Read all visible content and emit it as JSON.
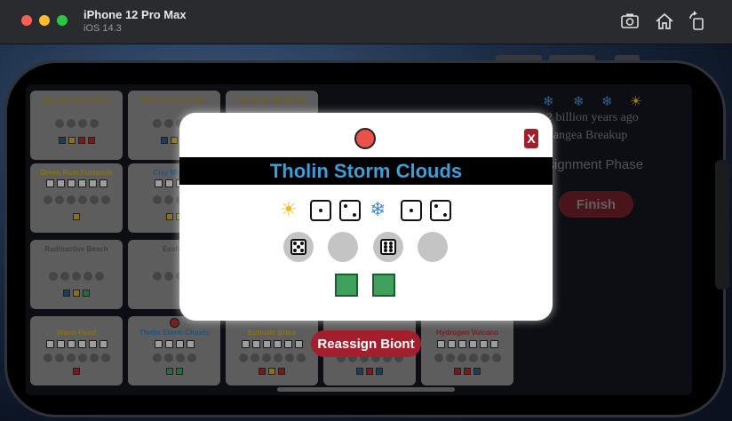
{
  "window": {
    "device_name": "iPhone 12 Pro Max",
    "os_version": "iOS 14.3"
  },
  "toolbar": {
    "icons": [
      "screenshot-icon",
      "home-icon",
      "rotate-icon"
    ]
  },
  "board": {
    "cards": [
      {
        "title": "Deep Hot Biosphere",
        "color": "#a78b2b"
      },
      {
        "title": "Mark Palace-Ocean",
        "color": "#a78b2b"
      },
      {
        "title": "Cambrian Mud Flats",
        "color": "#a78b2b"
      },
      {
        "title": "Green Rust Fumarole",
        "color": "#c9a91e"
      },
      {
        "title": "Clay Mineral",
        "color": "#2a7cc0"
      },
      {
        "title": "Radioactive Beach",
        "color": "#5d5d5d"
      },
      {
        "title": "Ecolite",
        "color": "#5d5d5d"
      },
      {
        "title": "Warm Pond",
        "color": "#c9a91e"
      },
      {
        "title": "Tholin Storm Clouds",
        "color": "#2a7cc0"
      },
      {
        "title": "Eutectic Brine",
        "color": "#c9a91e"
      },
      {
        "title": "Hydrogen Volcano",
        "color": "#b82a2a"
      }
    ]
  },
  "sidebar": {
    "time_text": "2 billion years ago",
    "era_text": "Pangea Breakup",
    "phase_text": "ssignment Phase",
    "finish_label": "Finish",
    "climate_icons": [
      "snowflake-icon",
      "snowflake-icon",
      "snowflake-icon",
      "sun-icon"
    ]
  },
  "modal": {
    "title": "Tholin Storm Clouds",
    "close_label": "X",
    "marker_color": "#e8524a",
    "title_color": "#3b9ed9",
    "climate_dice": [
      {
        "climate": "sun-icon",
        "dice": [
          1,
          2
        ]
      },
      {
        "climate": "snowflake-icon",
        "dice": [
          1,
          2
        ]
      }
    ],
    "biont_slots": [
      5,
      null,
      6,
      null
    ],
    "resource_squares": [
      "#3ea05a",
      "#3ea05a"
    ]
  },
  "actions": {
    "reassign_label": "Reassign Biont"
  }
}
